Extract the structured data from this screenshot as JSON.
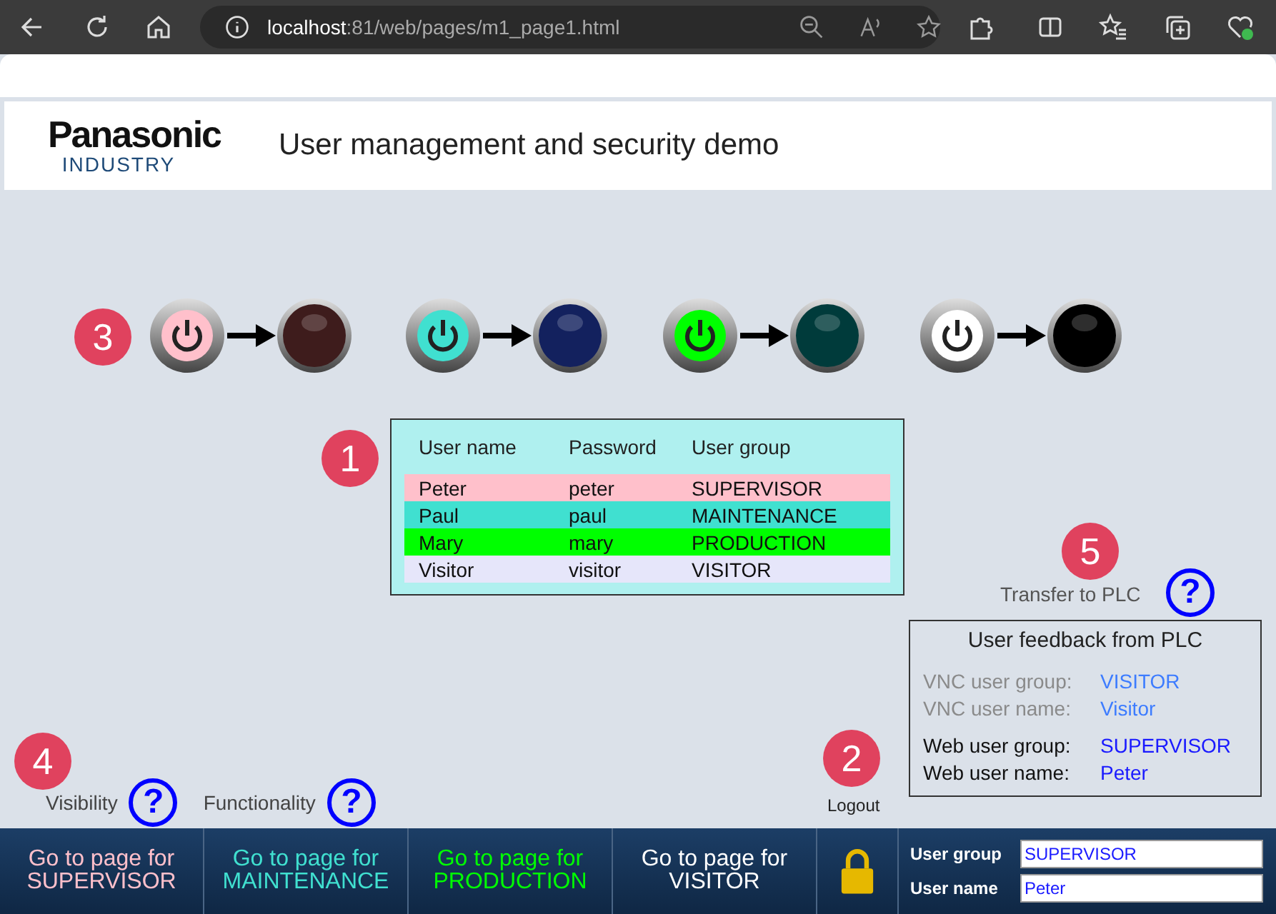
{
  "browser": {
    "url_host": "localhost",
    "url_rest": ":81/web/pages/m1_page1.html"
  },
  "header": {
    "logo": "Panasonic",
    "logo_sub": "INDUSTRY",
    "title": "User management and security demo"
  },
  "lamps": {
    "badge": "3",
    "pairs": [
      {
        "on_lamp": {
          "color": "#ffc0cb"
        },
        "off_lamp": {
          "color": "#3e1c1c"
        }
      },
      {
        "on_lamp": {
          "color": "#40e0d0"
        },
        "off_lamp": {
          "color": "#13215e"
        }
      },
      {
        "on_lamp": {
          "color": "#00ff00"
        },
        "off_lamp": {
          "color": "#003b3b"
        }
      },
      {
        "on_lamp": {
          "color": "#ffffff"
        },
        "off_lamp": {
          "color": "#000000"
        }
      }
    ]
  },
  "users": {
    "badge": "1",
    "columns": [
      "User name",
      "Password",
      "User group"
    ],
    "rows": [
      {
        "cells": [
          "Peter",
          "peter",
          "SUPERVISOR"
        ],
        "color": "#ffc0cb"
      },
      {
        "cells": [
          "Paul",
          "paul",
          "MAINTENANCE"
        ],
        "color": "#40e0d0"
      },
      {
        "cells": [
          "Mary",
          "mary",
          "PRODUCTION"
        ],
        "color": "#00ff00"
      },
      {
        "cells": [
          "Visitor",
          "visitor",
          "VISITOR"
        ],
        "color": "#e6e6fa"
      }
    ]
  },
  "transfer": {
    "badge": "5",
    "label": "Transfer to PLC",
    "help": "?"
  },
  "feedback": {
    "title": "User feedback from PLC",
    "rows": [
      {
        "kind": "vnc",
        "label": "VNC user group:",
        "value": "VISITOR"
      },
      {
        "kind": "vnc",
        "label": "VNC user name:",
        "value": "Visitor"
      },
      {
        "kind": "web",
        "label": "Web user group:",
        "value": "SUPERVISOR"
      },
      {
        "kind": "web",
        "label": "Web user name:",
        "value": "Peter"
      }
    ]
  },
  "hints": {
    "badge": "4",
    "items": [
      {
        "label": "Visibility",
        "help": "?"
      },
      {
        "label": "Functionality",
        "help": "?"
      }
    ]
  },
  "logout": {
    "badge": "2",
    "label": "Logout"
  },
  "nav": [
    {
      "line1": "Go to page for",
      "line2": "SUPERVISOR",
      "color": "#ffc0cb"
    },
    {
      "line1": "Go to page for",
      "line2": "MAINTENANCE",
      "color": "#40e0d0"
    },
    {
      "line1": "Go to page for",
      "line2": "PRODUCTION",
      "color": "#00ff00"
    },
    {
      "line1": "Go to page for",
      "line2": "VISITOR",
      "color": "#ffffff"
    }
  ],
  "login": {
    "group_label": "User group",
    "group_value": "SUPERVISOR",
    "name_label": "User name",
    "name_value": "Peter"
  }
}
